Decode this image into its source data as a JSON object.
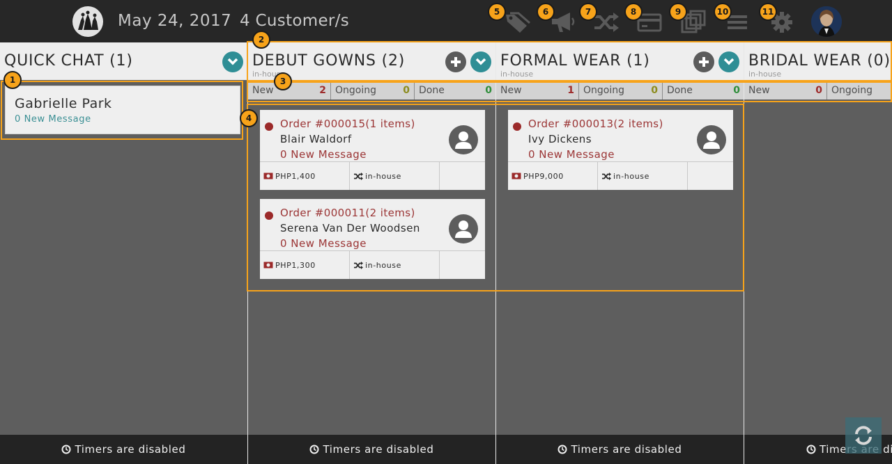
{
  "header": {
    "date": "May 24, 2017",
    "customers": "4 Customer/s",
    "icons": [
      "logo-icon",
      "tag-icon",
      "megaphone-icon",
      "shuffle-icon",
      "credit-card-icon",
      "layers-icon",
      "menu-icon",
      "gear-icon",
      "user-avatar"
    ]
  },
  "badges": [
    "1",
    "2",
    "3",
    "4",
    "5",
    "6",
    "7",
    "8",
    "9",
    "10",
    "11"
  ],
  "quick_chat": {
    "title": "QUICK CHAT (1)",
    "chat": {
      "name": "Gabrielle Park",
      "message": "0 New Message"
    },
    "footer": "Timers are disabled"
  },
  "columns": [
    {
      "title": "DEBUT GOWNS (2)",
      "subtitle": "in-house",
      "stats": {
        "new_label": "New",
        "new": "2",
        "ongoing_label": "Ongoing",
        "ongoing": "0",
        "done_label": "Done",
        "done": "0"
      },
      "orders": [
        {
          "title": "Order #000015(1 items)",
          "customer": "Blair Waldorf",
          "message": "0 New Message",
          "price": "PHP1,400",
          "type": "in-house"
        },
        {
          "title": "Order #000011(2 items)",
          "customer": "Serena Van Der Woodsen",
          "message": "0 New Message",
          "price": "PHP1,300",
          "type": "in-house"
        }
      ],
      "footer": "Timers are disabled"
    },
    {
      "title": "FORMAL WEAR (1)",
      "subtitle": "in-house",
      "stats": {
        "new_label": "New",
        "new": "1",
        "ongoing_label": "Ongoing",
        "ongoing": "0",
        "done_label": "Done",
        "done": "0"
      },
      "orders": [
        {
          "title": "Order #000013(2 items)",
          "customer": "Ivy Dickens",
          "message": "0 New Message",
          "price": "PHP9,000",
          "type": "in-house"
        }
      ],
      "footer": "Timers are disabled"
    },
    {
      "title": "BRIDAL WEAR (0)",
      "subtitle": "in-house",
      "stats": {
        "new_label": "New",
        "new": "0",
        "ongoing_label": "Ongoing",
        "ongoing": "",
        "done_label": "",
        "done": ""
      },
      "orders": [],
      "footer": "Timers are disabled"
    }
  ],
  "colors": {
    "accent": "#2f8e95",
    "badge": "#f7a31a",
    "order_red": "#9b3535",
    "topbar": "#272727"
  }
}
